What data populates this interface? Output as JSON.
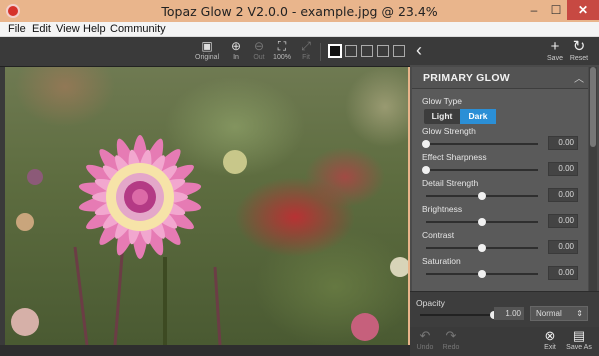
{
  "window": {
    "title": "Topaz Glow 2 V2.0.0 - example.jpg @ 23.4%",
    "min_glyph": "–",
    "max_glyph": "☐",
    "close_glyph": "✕"
  },
  "menu": [
    "File",
    "Edit",
    "View",
    "Help",
    "Community"
  ],
  "toolbar": {
    "original": "Original",
    "zoom_in": "In",
    "zoom_out": "Out",
    "hundred": "100%",
    "fit": "Fit"
  },
  "panel": {
    "save": "Save",
    "reset": "Reset",
    "section_title": "PRIMARY GLOW",
    "glow_type_label": "Glow Type",
    "glow_type_options": [
      "Light",
      "Dark"
    ],
    "glow_type_selected": "Dark",
    "sliders": [
      {
        "label": "Glow Strength",
        "value": "0.00",
        "level": 0.0
      },
      {
        "label": "Effect Sharpness",
        "value": "0.00",
        "level": 0.0
      },
      {
        "label": "Detail Strength",
        "value": "0.00",
        "level": 0.5
      },
      {
        "label": "Brightness",
        "value": "0.00",
        "level": 0.5
      },
      {
        "label": "Contrast",
        "value": "0.00",
        "level": 0.5
      },
      {
        "label": "Saturation",
        "value": "0.00",
        "level": 0.5
      }
    ],
    "opacity_label": "Opacity",
    "opacity_value": "1.00",
    "opacity_level": 1.0,
    "blend_mode": "Normal"
  },
  "actions": {
    "undo": "Undo",
    "redo": "Redo",
    "exit": "Exit",
    "save_as": "Save As"
  }
}
